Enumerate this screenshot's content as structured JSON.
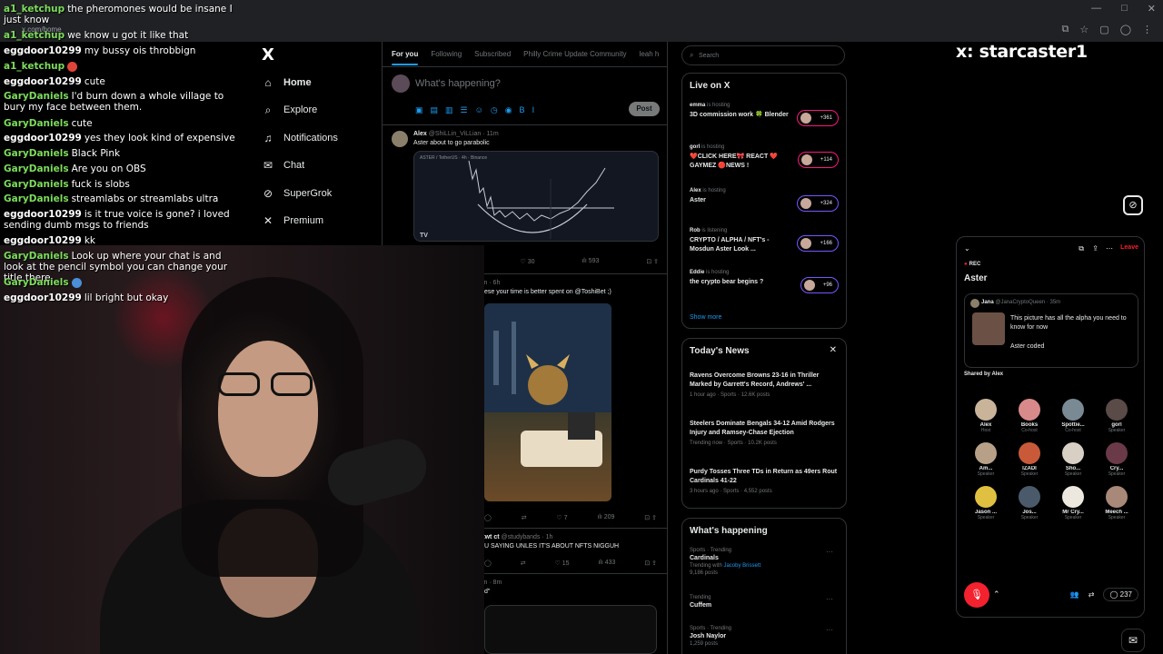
{
  "browser": {
    "url": "x.com/home",
    "window_controls": [
      "—",
      "□",
      "✕"
    ],
    "address_icons": [
      "⧉",
      "☆",
      "▢",
      "◯",
      "⋮"
    ]
  },
  "nav": {
    "logo": "X",
    "items": [
      {
        "label": "Home",
        "icon": "home-icon",
        "glyph": "⌂"
      },
      {
        "label": "Explore",
        "icon": "search-icon",
        "glyph": "⌕"
      },
      {
        "label": "Notifications",
        "icon": "bell-icon",
        "glyph": "♫"
      },
      {
        "label": "Chat",
        "icon": "mail-icon",
        "glyph": "✉"
      },
      {
        "label": "SuperGrok",
        "icon": "grok-icon",
        "glyph": "⊘"
      },
      {
        "label": "Premium",
        "icon": "x-icon",
        "glyph": "✕"
      }
    ]
  },
  "timeline": {
    "tabs": [
      "For you",
      "Following",
      "Subscribed",
      "Philly Crime Update Community",
      "leah h"
    ],
    "composer": {
      "placeholder": "What's happening?",
      "post_label": "Post",
      "tools": [
        "▣",
        "▤",
        "▥",
        "☰",
        "☺",
        "◷",
        "◉",
        "B",
        "I"
      ]
    },
    "tweets": [
      {
        "name": "Alex",
        "handle": "@ShiLLin_ViLLian · 11m",
        "text": "Aster about to go parabolic",
        "chart_label": "ASTER / TetherUS · 4h · Binance",
        "chart_logo": "TV",
        "stats": [
          "◯",
          "⇄",
          "♡ 30",
          "ılı 593",
          "⊡ ⇪"
        ]
      },
      {
        "name": "",
        "handle": "ian · 6h",
        "text": "ese your time is better spent on @ToshiBet ;)",
        "stats": [
          "◯",
          "⇄",
          "♡ 7",
          "ılı 209",
          "⊡ ⇪"
        ]
      },
      {
        "name": "gtwt ct",
        "handle": "@studybands · 1h",
        "text": "U SAYING UNLES IT'S ABOUT NFTS NIGGUH",
        "stats": [
          "◯",
          "⇄",
          "♡ 15",
          "ılı 433",
          "⊡ ⇪"
        ]
      },
      {
        "name": "",
        "handle": "ian · 8m",
        "text": "d\"",
        "stats": []
      }
    ]
  },
  "right": {
    "search_placeholder": "Search",
    "live": {
      "title": "Live on X",
      "items": [
        {
          "host": "emma",
          "status": "is hosting",
          "title": "3D commission work 🍀 Blender",
          "count": "+361",
          "color": "pink"
        },
        {
          "host": "gorl",
          "status": "is hosting",
          "title": "❤️CLICK HERE🎀 REACT ❤️ GAYMEZ 🔴NEWS !",
          "count": "+114",
          "color": "pink"
        },
        {
          "host": "Alex",
          "status": "is hosting",
          "title": "Aster",
          "count": "+324",
          "color": "blue"
        },
        {
          "host": "Rob",
          "status": "is listening",
          "title": "CRYPTO / ALPHA / NFT's - Mosdun Aster Look ...",
          "count": "+166",
          "color": "blue"
        },
        {
          "host": "Eddie",
          "status": "is hosting",
          "title": "the crypto bear begins ?",
          "count": "+96",
          "color": "blue"
        }
      ],
      "show_more": "Show more"
    },
    "news": {
      "title": "Today's News",
      "items": [
        {
          "title": "Ravens Overcome Browns 23-16 in Thriller Marked by Garrett's Record, Andrews' ...",
          "meta": "1 hour ago · Sports · 12.6K posts"
        },
        {
          "title": "Steelers Dominate Bengals 34-12 Amid Rodgers Injury and Ramsey-Chase Ejection",
          "meta": "Trending now · Sports · 10.2K posts"
        },
        {
          "title": "Purdy Tosses Three TDs in Return as 49ers Rout Cardinals 41-22",
          "meta": "3 hours ago · Sports · 4,552 posts"
        }
      ]
    },
    "happening": {
      "title": "What's happening",
      "items": [
        {
          "category": "Sports · Trending",
          "name": "Cardinals",
          "extra_prefix": "Trending with",
          "extra_link": "Jacoby Brissett",
          "posts": "9,186 posts"
        },
        {
          "category": "Trending",
          "name": "Cuffem",
          "extra_prefix": "",
          "extra_link": "",
          "posts": ""
        },
        {
          "category": "Sports · Trending",
          "name": "Josh Naylor",
          "extra_prefix": "",
          "extra_link": "",
          "posts": "1,259 posts"
        }
      ]
    }
  },
  "stream_title": "x: starcaster1",
  "spaces": {
    "rec": "REC",
    "leave": "Leave",
    "title": "Aster",
    "pinned": {
      "name": "Jana",
      "handle": "@JanaCryptoQueen · 35m",
      "text": "This picture has all the alpha you need to know for now",
      "coded": "Aster coded"
    },
    "shared_by": "Shared by Alex",
    "users": [
      {
        "name": "Alex",
        "role": "Host"
      },
      {
        "name": "Books",
        "role": "Co-host"
      },
      {
        "name": "Spottie...",
        "role": "Co-host"
      },
      {
        "name": "gorl",
        "role": "Speaker"
      },
      {
        "name": "Am...",
        "role": "Speaker"
      },
      {
        "name": "IZADI",
        "role": "Speaker"
      },
      {
        "name": "Sho...",
        "role": "Speaker"
      },
      {
        "name": "Cry...",
        "role": "Speaker"
      },
      {
        "name": "Jason ...",
        "role": "Speaker"
      },
      {
        "name": "Jos...",
        "role": "Speaker"
      },
      {
        "name": "Mr Cry...",
        "role": "Speaker"
      },
      {
        "name": "Meech ...",
        "role": "Speaker"
      }
    ],
    "reply_count": "237"
  },
  "chat": [
    {
      "user": "a1_ketchup",
      "msg": "the pheromones would be insane I just know",
      "color": "green"
    },
    {
      "user": "a1_ketchup",
      "msg": "we know u got it like that",
      "color": "green"
    },
    {
      "user": "eggdoor10299",
      "msg": "my bussy ois throbbign",
      "color": "white"
    },
    {
      "user": "a1_ketchup",
      "msg": "",
      "color": "green",
      "emoji": "#e0443a"
    },
    {
      "user": "eggdoor10299",
      "msg": "cute",
      "color": "white"
    },
    {
      "user": "GaryDaniels",
      "msg": "I'd burn down a whole village to bury my face between them.",
      "color": "green"
    },
    {
      "user": "GaryDaniels",
      "msg": "cute",
      "color": "green"
    },
    {
      "user": "eggdoor10299",
      "msg": "yes they look kind of expensive",
      "color": "white"
    },
    {
      "user": "GaryDaniels",
      "msg": "Black Pink",
      "color": "green"
    },
    {
      "user": "GaryDaniels",
      "msg": "Are you on OBS",
      "color": "green"
    },
    {
      "user": "GaryDaniels",
      "msg": "fuck is slobs",
      "color": "green"
    },
    {
      "user": "GaryDaniels",
      "msg": "streamlabs or streamlabs ultra",
      "color": "green"
    },
    {
      "user": "eggdoor10299",
      "msg": "is it true voice is gone? i loved sending dumb msgs to friends",
      "color": "white"
    },
    {
      "user": "eggdoor10299",
      "msg": "kk",
      "color": "white"
    },
    {
      "user": "GaryDaniels",
      "msg": "Look up where your chat is and look at the pencil symbol you can change your title there",
      "color": "green"
    },
    {
      "user": "GaryDaniels",
      "msg": "",
      "color": "green",
      "emoji": "#4a8fd8"
    },
    {
      "user": "eggdoor10299",
      "msg": "lil bright but okay",
      "color": "white"
    }
  ]
}
